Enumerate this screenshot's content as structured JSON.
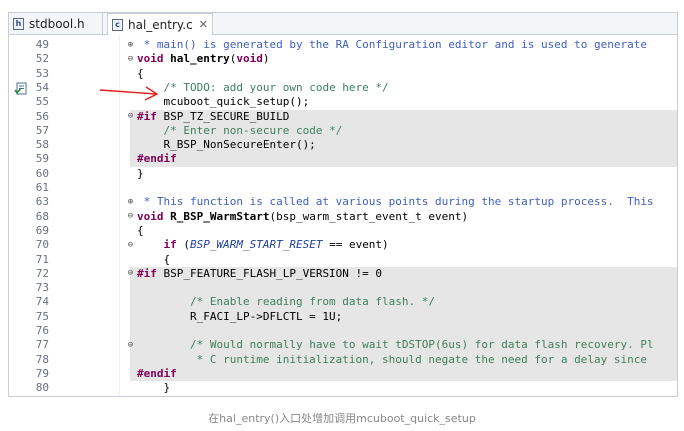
{
  "tabs": [
    {
      "label": "stdbool.h",
      "icon": "c-header-file-icon",
      "active": false
    },
    {
      "label": "hal_entry.c",
      "icon": "c-source-file-icon",
      "active": true
    }
  ],
  "lines": [
    {
      "n": "49",
      "fold": "+",
      "shade": false,
      "html": "<span class=\"dc\"> * main() is generated by the RA Configuration editor and is used to generate</span>"
    },
    {
      "n": "52",
      "fold": "-",
      "shade": false,
      "html": "<span class=\"kw\">void</span> <b>hal_entry</b>(<span class=\"kw\">void</span>)"
    },
    {
      "n": "53",
      "fold": "",
      "shade": false,
      "html": "{"
    },
    {
      "n": "54",
      "fold": "",
      "shade": false,
      "html": "    <span class=\"cm\">/* TODO: add your own code here */</span>"
    },
    {
      "n": "55",
      "fold": "",
      "shade": false,
      "html": "    mcuboot_quick_setup();"
    },
    {
      "n": "56",
      "fold": "-",
      "shade": true,
      "html": "<span class=\"kw\">#if</span> BSP_TZ_SECURE_BUILD"
    },
    {
      "n": "57",
      "fold": "",
      "shade": true,
      "html": "    <span class=\"cm\">/* Enter non-secure code */</span>"
    },
    {
      "n": "58",
      "fold": "",
      "shade": true,
      "html": "    R_BSP_NonSecureEnter();"
    },
    {
      "n": "59",
      "fold": "",
      "shade": true,
      "html": "<span class=\"kw\">#endif</span>"
    },
    {
      "n": "60",
      "fold": "",
      "shade": false,
      "html": "}"
    },
    {
      "n": "61",
      "fold": "",
      "shade": false,
      "html": ""
    },
    {
      "n": "63",
      "fold": "+",
      "shade": false,
      "html": "<span class=\"dc\"> * This function is called at various points during the startup process.  This</span>"
    },
    {
      "n": "68",
      "fold": "-",
      "shade": false,
      "html": "<span class=\"kw\">void</span> <b>R_BSP_WarmStart</b>(bsp_warm_start_event_t event)"
    },
    {
      "n": "69",
      "fold": "",
      "shade": false,
      "html": "{"
    },
    {
      "n": "70",
      "fold": "-",
      "shade": false,
      "html": "    <span class=\"kw\">if</span> (<span class=\"mac\">BSP_WARM_START_RESET</span> == event)"
    },
    {
      "n": "71",
      "fold": "",
      "shade": false,
      "html": "    {"
    },
    {
      "n": "72",
      "fold": "-",
      "shade": true,
      "html": "<span class=\"kw\">#if</span> BSP_FEATURE_FLASH_LP_VERSION != 0"
    },
    {
      "n": "73",
      "fold": "",
      "shade": true,
      "html": ""
    },
    {
      "n": "74",
      "fold": "",
      "shade": true,
      "html": "        <span class=\"cm\">/* Enable reading from data flash. */</span>"
    },
    {
      "n": "75",
      "fold": "",
      "shade": true,
      "html": "        R_FACI_LP-&gt;DFLCTL = 1U;"
    },
    {
      "n": "76",
      "fold": "",
      "shade": true,
      "html": ""
    },
    {
      "n": "77",
      "fold": "-",
      "shade": true,
      "html": "        <span class=\"cm\">/* Would normally have to wait tDSTOP(6us) for data flash recovery. Pl</span>"
    },
    {
      "n": "78",
      "fold": "",
      "shade": true,
      "html": "<span class=\"cm\">         * C runtime initialization, should negate the need for a delay since</span>"
    },
    {
      "n": "79",
      "fold": "",
      "shade": true,
      "html": "<span class=\"kw\">#endif</span>"
    },
    {
      "n": "80",
      "fold": "",
      "shade": false,
      "html": "    }"
    }
  ],
  "task_marker_line": "54",
  "caption": "在hal_entry()入口处增加调用mcuboot_quick_setup"
}
